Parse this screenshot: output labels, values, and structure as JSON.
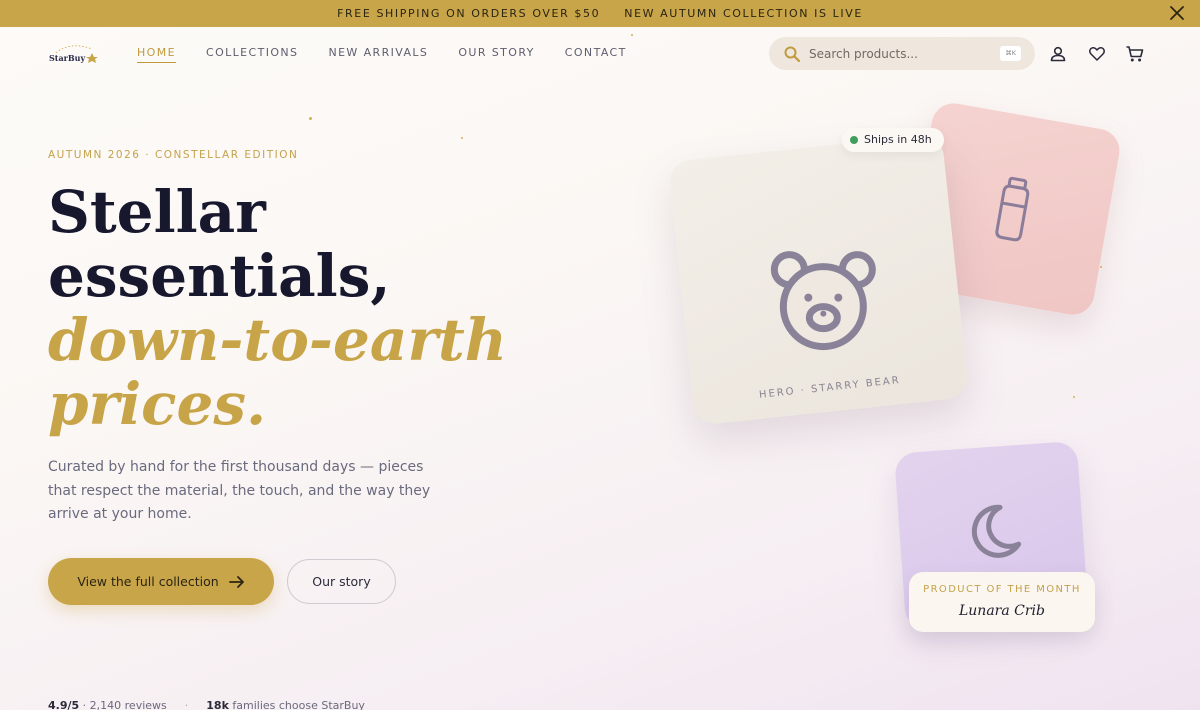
{
  "announcement": {
    "messages": [
      "FREE SHIPPING ON ORDERS OVER $50",
      "NEW AUTUMN COLLECTION IS LIVE"
    ],
    "close_icon": "close-icon"
  },
  "nav": {
    "logo_text": "StarBuy",
    "links": [
      {
        "label": "HOME",
        "active": true
      },
      {
        "label": "COLLECTIONS",
        "active": false
      },
      {
        "label": "NEW ARRIVALS",
        "active": false
      },
      {
        "label": "OUR STORY",
        "active": false
      },
      {
        "label": "CONTACT",
        "active": false
      }
    ],
    "search": {
      "placeholder": "Search products...",
      "shortcut": "⌘K"
    },
    "icons": [
      "account-icon",
      "heart-icon",
      "cart-icon"
    ]
  },
  "hero": {
    "eyebrow": "AUTUMN 2026 · CONSTELLAR EDITION",
    "headline_line1": "Stellar",
    "headline_line2": "essentials,",
    "headline_line3": "down-to-earth",
    "headline_line4": "prices.",
    "lede": "Curated by hand for the first thousand days — pieces that respect the material, the touch, and the way they arrive at your home.",
    "primary_cta": "View the full collection",
    "secondary_cta": "Our story"
  },
  "stats": {
    "rating": "4.9/5",
    "reviews": "· 2,140 reviews",
    "families_count": "18k",
    "families_text": "families choose StarBuy"
  },
  "showcase": {
    "hero_card_label": "HERO · STARRY BEAR",
    "ships_badge": "Ships in 48h",
    "potm_title": "PRODUCT OF THE MONTH",
    "potm_name": "Lunara Crib",
    "colors": {
      "gold": "#c9a54a",
      "navy": "#17182e",
      "pink": "#f2cdca",
      "lavender": "#ddcdec",
      "green": "#3f9e5b"
    }
  }
}
